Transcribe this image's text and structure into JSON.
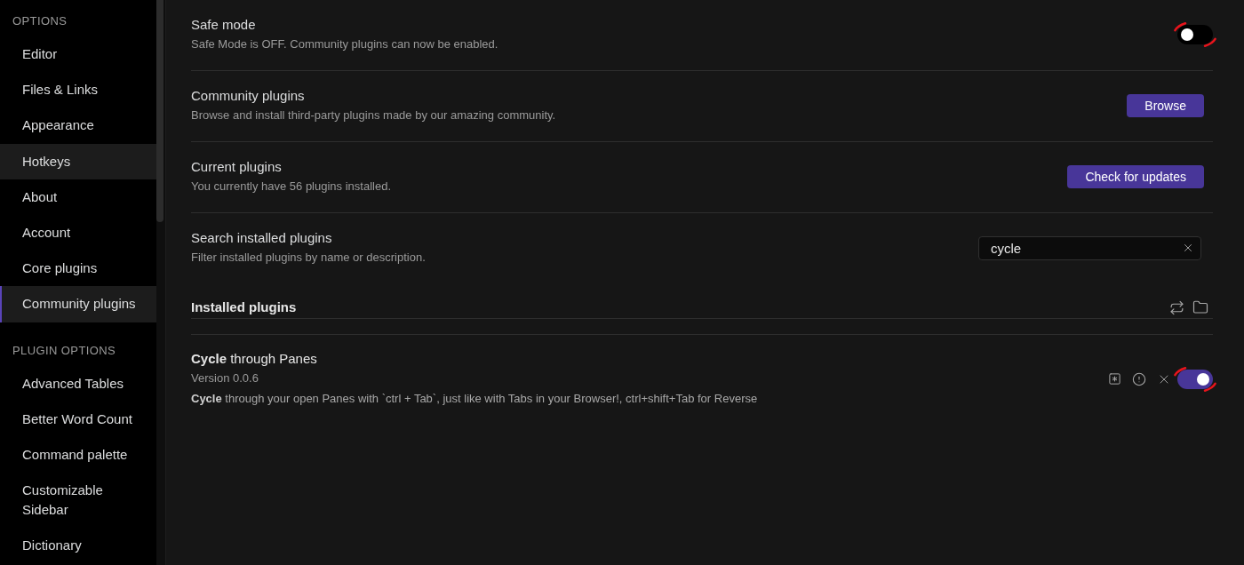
{
  "sidebar": {
    "sections": [
      {
        "heading": "OPTIONS",
        "items": [
          {
            "label": "Editor",
            "selected": false,
            "hovered": false
          },
          {
            "label": "Files & Links",
            "selected": false,
            "hovered": false
          },
          {
            "label": "Appearance",
            "selected": false,
            "hovered": false
          },
          {
            "label": "Hotkeys",
            "selected": false,
            "hovered": true
          },
          {
            "label": "About",
            "selected": false,
            "hovered": false
          },
          {
            "label": "Account",
            "selected": false,
            "hovered": false
          },
          {
            "label": "Core plugins",
            "selected": false,
            "hovered": false
          },
          {
            "label": "Community plugins",
            "selected": true,
            "hovered": false
          }
        ]
      },
      {
        "heading": "PLUGIN OPTIONS",
        "items": [
          {
            "label": "Advanced Tables",
            "selected": false,
            "hovered": false
          },
          {
            "label": "Better Word Count",
            "selected": false,
            "hovered": false
          },
          {
            "label": "Command palette",
            "selected": false,
            "hovered": false
          },
          {
            "label": "Customizable Sidebar",
            "selected": false,
            "hovered": false
          },
          {
            "label": "Dictionary",
            "selected": false,
            "hovered": false
          }
        ]
      }
    ]
  },
  "settings": [
    {
      "kind": "toggle",
      "name": "Safe mode",
      "description": "Safe Mode is OFF. Community plugins can now be enabled.",
      "toggle": {
        "on": false,
        "annotated": true
      }
    },
    {
      "kind": "button",
      "name": "Community plugins",
      "description": "Browse and install third-party plugins made by our amazing community.",
      "button": "Browse"
    },
    {
      "kind": "button",
      "name": "Current plugins",
      "description": "You currently have 56 plugins installed.",
      "button": "Check for updates"
    },
    {
      "kind": "search",
      "name": "Search installed plugins",
      "description": "Filter installed plugins by name or description.",
      "search": {
        "value": "cycle"
      }
    }
  ],
  "installed_plugins": {
    "heading": "Installed plugins",
    "plugins": [
      {
        "name": "**Cycle** through Panes",
        "version": "Version 0.0.6",
        "description": "**Cycle** through your open Panes with `ctrl + Tab`, just like with Tabs in your Browser!, ctrl+shift+Tab for Reverse",
        "enabled": true,
        "annotated": true
      }
    ]
  }
}
